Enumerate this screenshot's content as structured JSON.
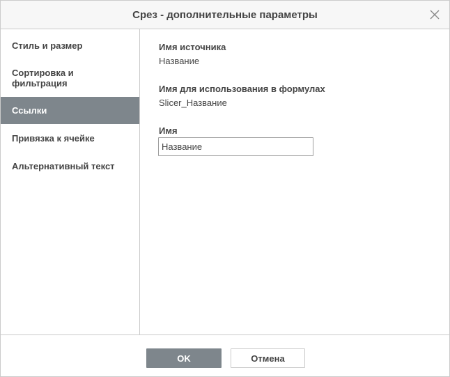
{
  "dialog": {
    "title": "Срез - дополнительные параметры"
  },
  "sidebar": {
    "items": [
      {
        "label": "Стиль и размер",
        "active": false
      },
      {
        "label_line1": "Сортировка и",
        "label_line2": "фильтрация",
        "active": false
      },
      {
        "label": "Ссылки",
        "active": true
      },
      {
        "label": "Привязка к ячейке",
        "active": false
      },
      {
        "label": "Альтернативный текст",
        "active": false
      }
    ]
  },
  "content": {
    "source_name_label": "Имя источника",
    "source_name_value": "Название",
    "formula_name_label": "Имя для использования в формулах",
    "formula_name_value": "Slicer_Название",
    "name_label": "Имя",
    "name_input_value": "Название"
  },
  "footer": {
    "ok_label": "OK",
    "cancel_label": "Отмена"
  },
  "icons": {
    "close": "close-icon"
  },
  "colors": {
    "accent": "#7e868c",
    "border": "#cbcbcb",
    "titlebar_bg": "#f7f7f7",
    "text": "#444444"
  }
}
